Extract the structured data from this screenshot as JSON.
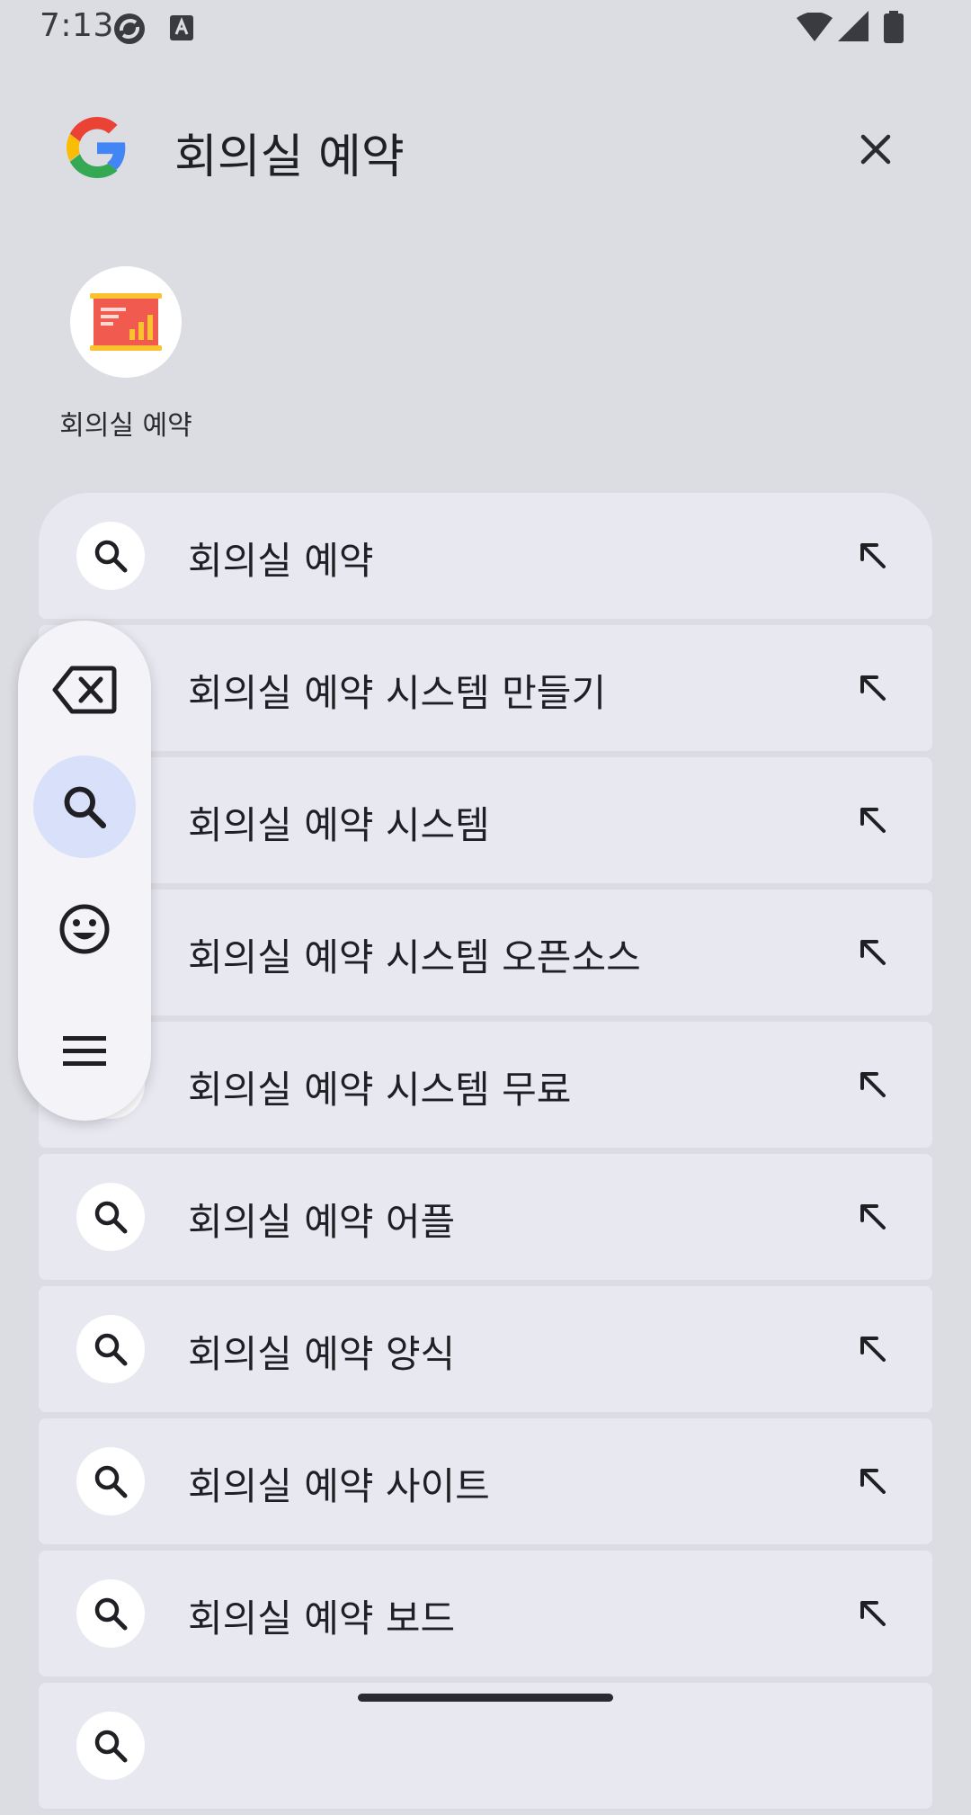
{
  "status_bar": {
    "time": "7:13",
    "icons": [
      "sync-icon",
      "keyboard-a-icon",
      "wifi-icon",
      "signal-icon",
      "battery-icon"
    ]
  },
  "search": {
    "query": "회의실 예약",
    "logo": "google-g-logo",
    "clear_icon": "close-icon"
  },
  "app_result": {
    "label": "회의실 예약",
    "icon": "presentation-chart-icon"
  },
  "suggestions": [
    {
      "text": "회의실 예약"
    },
    {
      "text": "회의실 예약 시스템 만들기"
    },
    {
      "text": "회의실 예약 시스템"
    },
    {
      "text": "회의실 예약 시스템 오픈소스"
    },
    {
      "text": "회의실 예약 시스템 무료"
    },
    {
      "text": "회의실 예약 어플"
    },
    {
      "text": "회의실 예약 양식"
    },
    {
      "text": "회의실 예약 사이트"
    },
    {
      "text": "회의실 예약 보드"
    },
    {
      "text": ""
    }
  ],
  "float_toolbar": {
    "buttons": [
      "backspace-icon",
      "search-icon",
      "emoji-icon",
      "menu-icon"
    ],
    "active": "search-icon"
  },
  "colors": {
    "background": "#dcdde3",
    "suggestion_bg": "#e8e8f1",
    "active_button": "#d8e0fa",
    "app_icon_red": "#f05a4f",
    "app_icon_yellow": "#f9c22e"
  }
}
